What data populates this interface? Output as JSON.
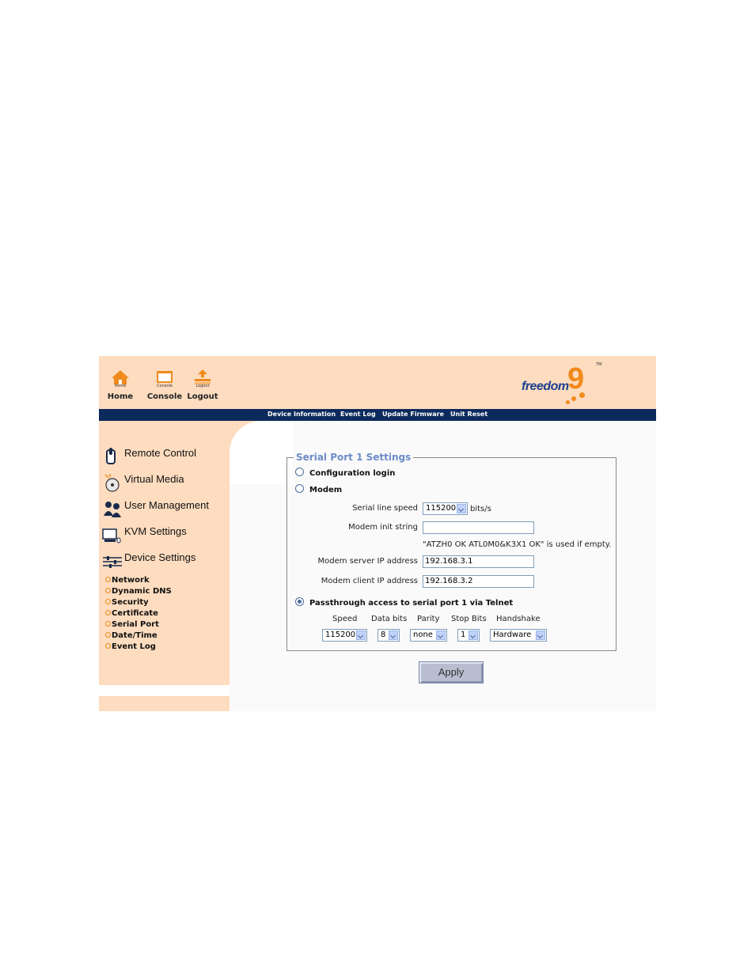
{
  "toolbar": {
    "home": {
      "small": "Home",
      "label": "Home"
    },
    "console": {
      "small": "Console",
      "label": "Console"
    },
    "logout": {
      "small": "Logout",
      "label": "Logout"
    }
  },
  "logo": {
    "word": "freedom",
    "digit": "9",
    "tm": "TM"
  },
  "nav": [
    "Device Information",
    "Event Log",
    "Update Firmware",
    "Unit Reset"
  ],
  "sidebar": {
    "menu": [
      "Remote Control",
      "Virtual Media",
      "User Management",
      "KVM Settings",
      "Device Settings"
    ],
    "submenu": [
      "Network",
      "Dynamic DNS",
      "Security",
      "Certificate",
      "Serial Port",
      "Date/Time",
      "Event Log"
    ],
    "active": "Serial Port"
  },
  "serial": {
    "legend": "Serial Port 1 Settings",
    "config_login": "Configuration login",
    "modem": "Modem",
    "line_speed_label": "Serial line speed",
    "line_speed_value": "115200",
    "line_speed_unit": "bits/s",
    "init_label": "Modem init string",
    "init_value": "",
    "init_hint": "\"ATZH0 OK ATL0M0&K3X1 OK\" is used if empty.",
    "server_ip_label": "Modem server IP address",
    "server_ip_value": "192.168.3.1",
    "client_ip_label": "Modem client IP address",
    "client_ip_value": "192.168.3.2",
    "passthrough": "Passthrough access to serial port 1 via Telnet",
    "selected_mode": "passthrough",
    "columns": [
      "Speed",
      "Data bits",
      "Parity",
      "Stop Bits",
      "Handshake"
    ],
    "values": [
      "115200",
      "8",
      "none",
      "1",
      "Hardware"
    ]
  },
  "apply_label": "Apply",
  "colors": {
    "peach": "#fddcbf",
    "navy": "#0c2a5c",
    "orange": "#f08a1c",
    "legend": "#6b8cc9"
  }
}
